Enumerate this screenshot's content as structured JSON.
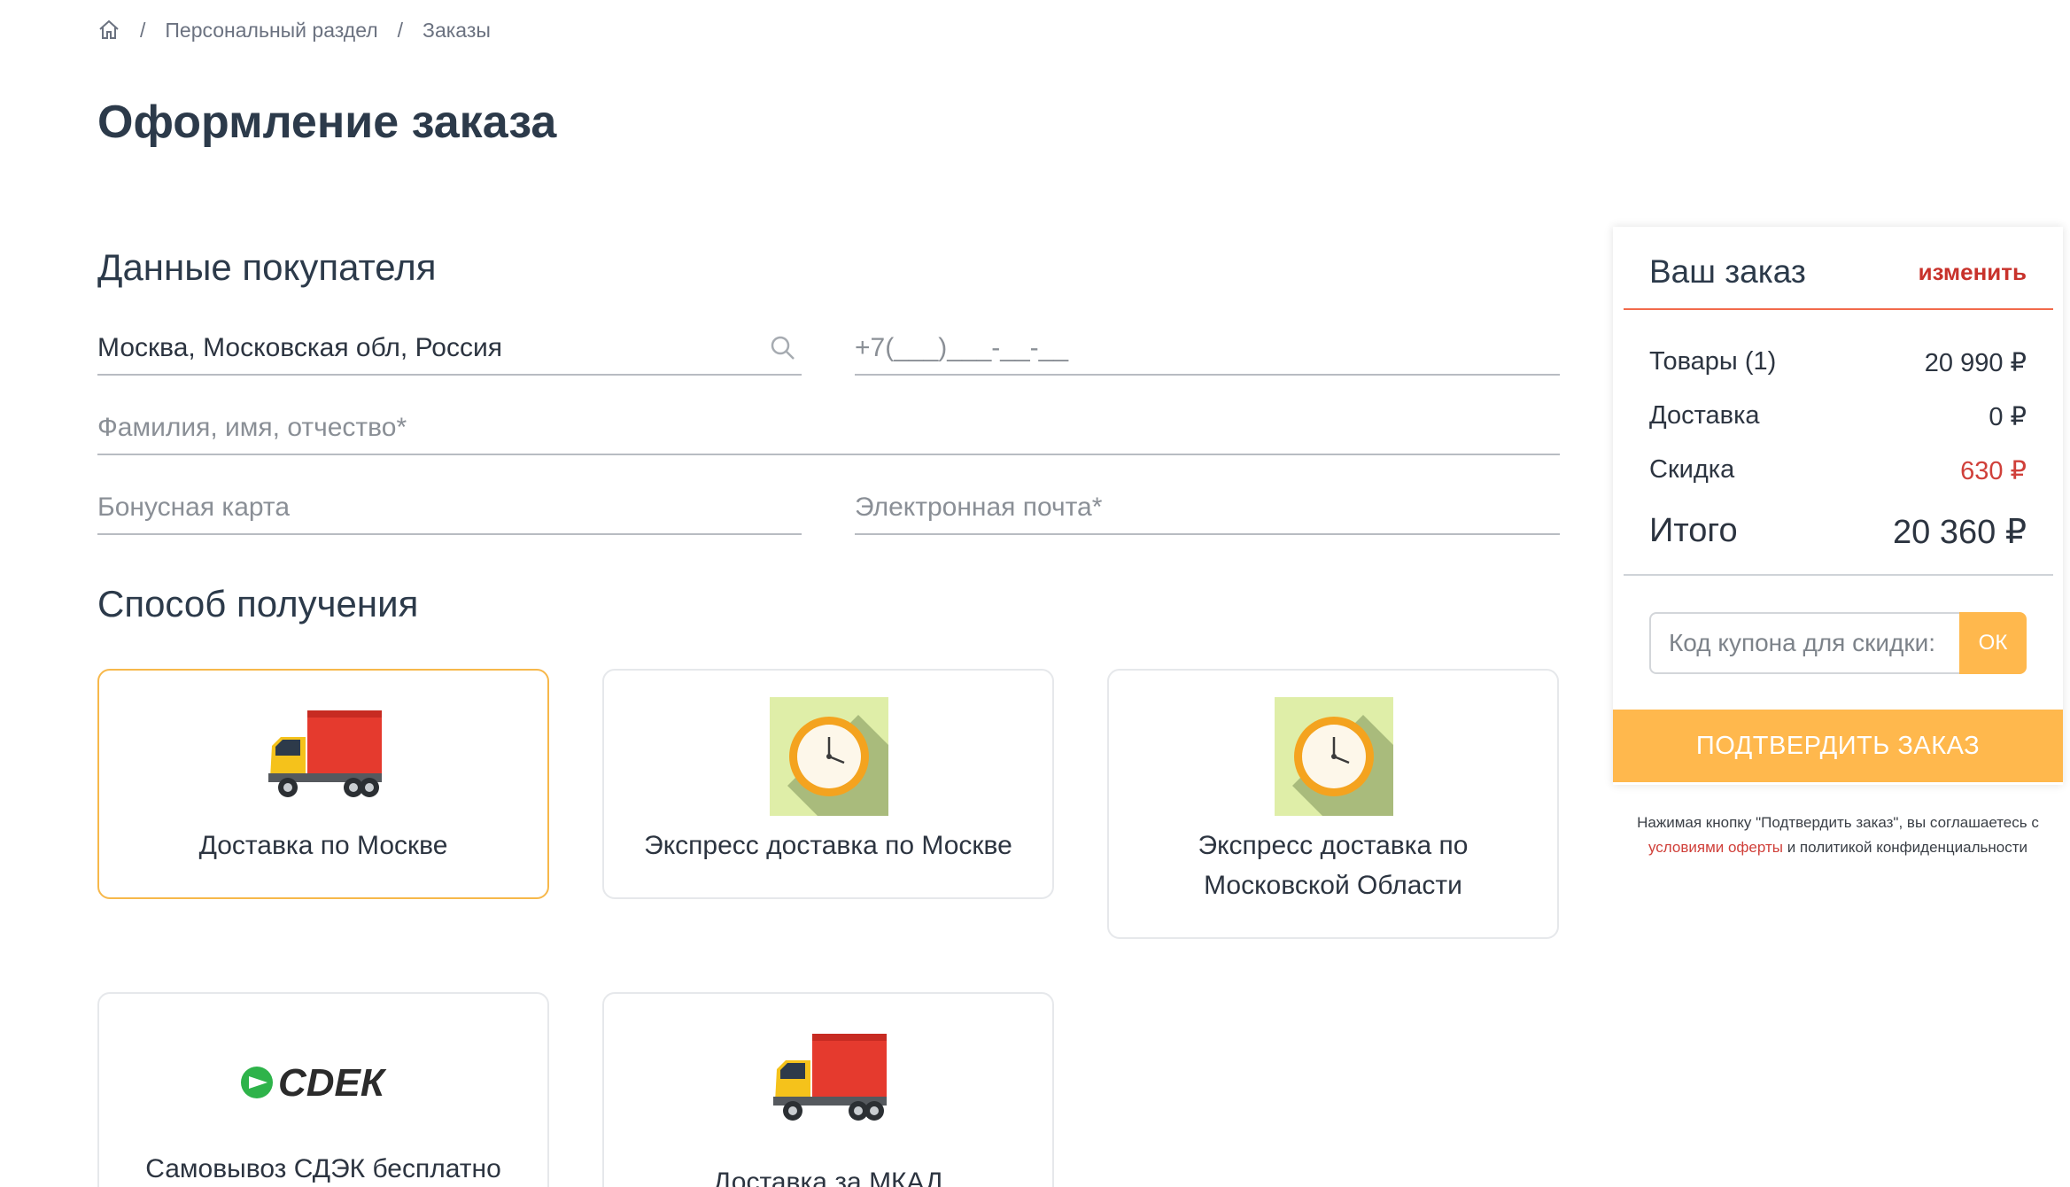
{
  "breadcrumb": {
    "home_icon": "home-icon",
    "separator": "/",
    "items": [
      "Персональный раздел",
      "Заказы"
    ]
  },
  "page": {
    "title": "Оформление заказа"
  },
  "buyer": {
    "title": "Данные покупателя",
    "city": {
      "value": "Москва, Московская обл, Россия",
      "icon": "search-icon"
    },
    "phone": {
      "placeholder": "+7(___)___-__-__"
    },
    "name": {
      "placeholder": "Фамилия, имя, отчество*"
    },
    "bonus": {
      "placeholder": "Бонусная карта"
    },
    "email": {
      "placeholder": "Электронная почта*"
    }
  },
  "delivery": {
    "title": "Способ получения",
    "options": [
      {
        "label": "Доставка по Москве",
        "icon": "delivery-truck-icon",
        "selected": true
      },
      {
        "label": "Экспресс доставка по Москве",
        "icon": "clock-icon",
        "selected": false
      },
      {
        "label": "Экспресс доставка по Московской Области",
        "icon": "clock-icon",
        "selected": false
      },
      {
        "label": "Самовывоз СДЭК бесплатно",
        "icon": "cdek-logo",
        "logo_text": "СDЕК",
        "selected": false
      },
      {
        "label": "Доставка за МКАД",
        "icon": "delivery-truck-icon",
        "selected": false
      }
    ]
  },
  "order": {
    "title": "Ваш заказ",
    "edit_label": "изменить",
    "rows": [
      {
        "label": "Товары (1)",
        "value": "20 990 ₽"
      },
      {
        "label": "Доставка",
        "value": "0 ₽"
      },
      {
        "label": "Скидка",
        "value": "630 ₽"
      },
      {
        "label": "Итого",
        "value": "20 360 ₽"
      }
    ],
    "coupon": {
      "placeholder": "Код купона для скидки:",
      "button": "ОК"
    },
    "confirm_label": "ПОДТВЕРДИТЬ ЗАКАЗ",
    "legal": {
      "text_1": "Нажимая кнопку \"Подтвердить заказ\", вы соглашаетесь с",
      "link": "условиями оферты",
      "text_2": "и политикой конфиденциальности"
    }
  },
  "colors": {
    "accent": "#ffb84d",
    "selected_border": "#f7b84b",
    "danger": "#d0403a",
    "title": "#2c3a4a"
  }
}
